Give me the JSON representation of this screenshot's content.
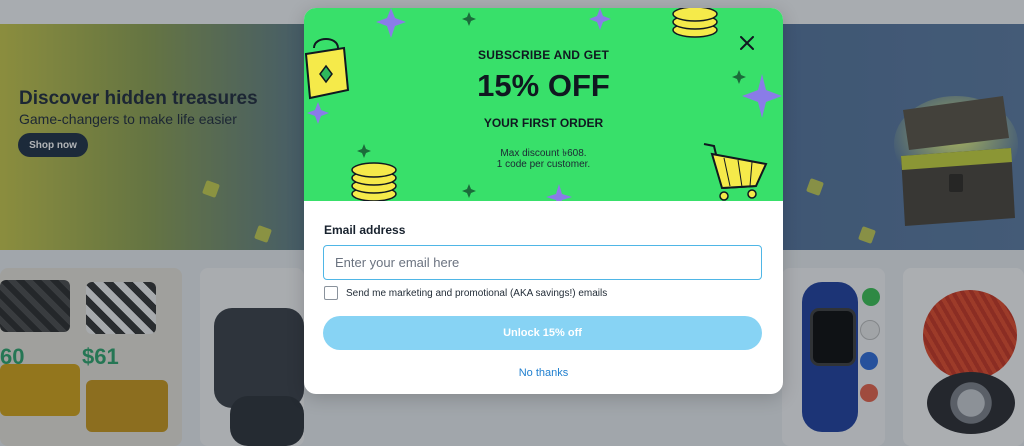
{
  "hero": {
    "title": "Discover hidden treasures",
    "subtitle": "Game-changers to make life easier",
    "cta_label": "Shop now"
  },
  "products": {
    "tile1_price_a": "60",
    "tile1_price_b": "$61"
  },
  "modal": {
    "kicker": "SUBSCRIBE AND GET",
    "headline": "15% OFF",
    "subheadline": "YOUR FIRST ORDER",
    "fine_print_1": "Max discount ৳608.",
    "fine_print_2": "1 code per customer.",
    "email_label": "Email address",
    "email_placeholder": "Enter your email here",
    "email_value": "",
    "consent_label": "Send me marketing and promotional (AKA savings!) emails",
    "consent_checked": false,
    "unlock_label": "Unlock 15% off",
    "no_thanks_label": "No thanks"
  },
  "colors": {
    "promo_bg": "#38e06a",
    "unlock_button": "#87d3f4",
    "link": "#1f7fcf",
    "input_border": "#4fb6e6"
  },
  "icons": [
    "close-icon",
    "shopping-bag-icon",
    "coin-stack-icon",
    "shopping-cart-icon",
    "sparkle-star-icon",
    "treasure-chest-icon"
  ]
}
